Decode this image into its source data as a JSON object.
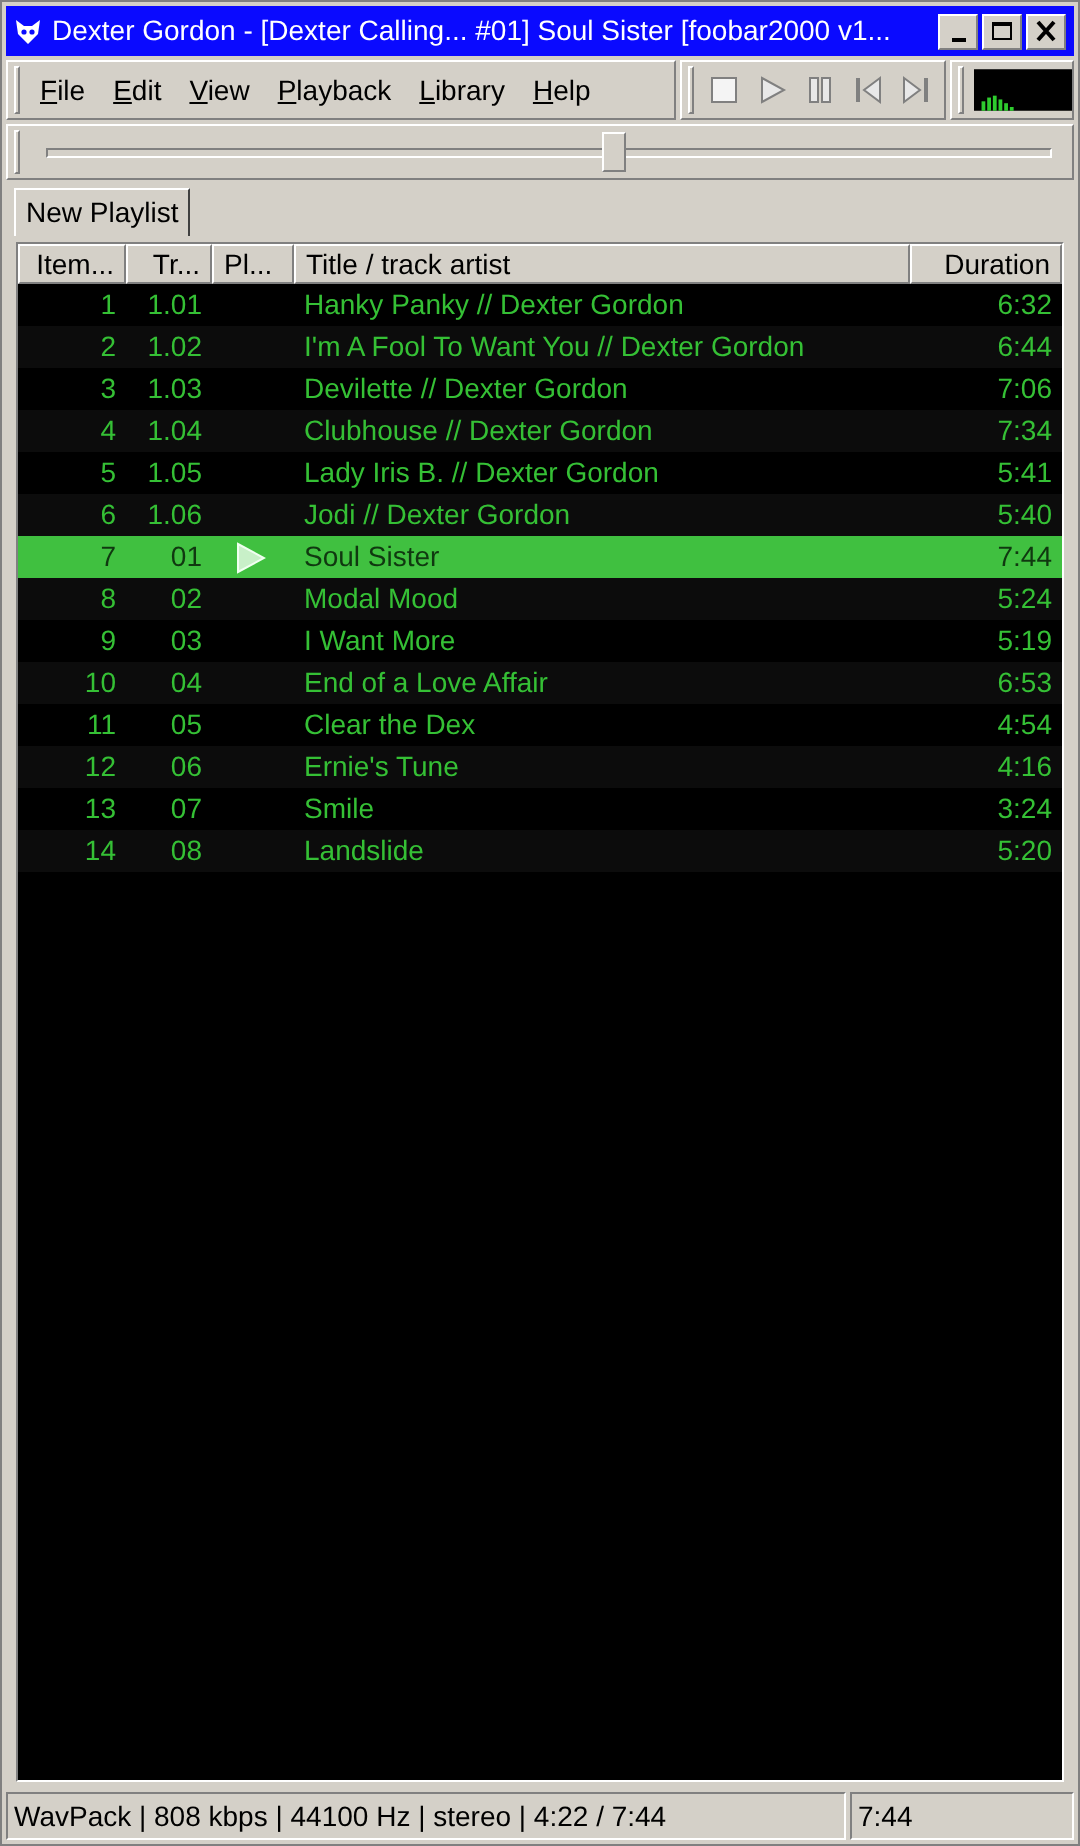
{
  "window": {
    "title": "Dexter Gordon - [Dexter Calling... #01] Soul Sister   [foobar2000 v1..."
  },
  "menu": [
    "File",
    "Edit",
    "View",
    "Playback",
    "Library",
    "Help"
  ],
  "seek": {
    "level": 0.565
  },
  "tabs": [
    {
      "label": "New Playlist",
      "selected": true
    }
  ],
  "columns": [
    "Item...",
    "Tr...",
    "Pl...",
    "Title / track artist",
    "Duration"
  ],
  "rows": [
    {
      "index": "1",
      "track": "1.01",
      "title": "Hanky Panky // Dexter Gordon",
      "duration": "6:32",
      "selected": false,
      "playing": false
    },
    {
      "index": "2",
      "track": "1.02",
      "title": "I'm A Fool To Want You // Dexter Gordon",
      "duration": "6:44",
      "selected": false,
      "playing": false
    },
    {
      "index": "3",
      "track": "1.03",
      "title": "Devilette // Dexter Gordon",
      "duration": "7:06",
      "selected": false,
      "playing": false
    },
    {
      "index": "4",
      "track": "1.04",
      "title": "Clubhouse // Dexter Gordon",
      "duration": "7:34",
      "selected": false,
      "playing": false
    },
    {
      "index": "5",
      "track": "1.05",
      "title": "Lady Iris B. // Dexter Gordon",
      "duration": "5:41",
      "selected": false,
      "playing": false
    },
    {
      "index": "6",
      "track": "1.06",
      "title": "Jodi // Dexter Gordon",
      "duration": "5:40",
      "selected": false,
      "playing": false
    },
    {
      "index": "7",
      "track": "01",
      "title": "Soul Sister",
      "duration": "7:44",
      "selected": true,
      "playing": true
    },
    {
      "index": "8",
      "track": "02",
      "title": "Modal Mood",
      "duration": "5:24",
      "selected": false,
      "playing": false
    },
    {
      "index": "9",
      "track": "03",
      "title": "I Want More",
      "duration": "5:19",
      "selected": false,
      "playing": false
    },
    {
      "index": "10",
      "track": "04",
      "title": "End of a Love Affair",
      "duration": "6:53",
      "selected": false,
      "playing": false
    },
    {
      "index": "11",
      "track": "05",
      "title": "Clear the Dex",
      "duration": "4:54",
      "selected": false,
      "playing": false
    },
    {
      "index": "12",
      "track": "06",
      "title": "Ernie's Tune",
      "duration": "4:16",
      "selected": false,
      "playing": false
    },
    {
      "index": "13",
      "track": "07",
      "title": "Smile",
      "duration": "3:24",
      "selected": false,
      "playing": false
    },
    {
      "index": "14",
      "track": "08",
      "title": "Landslide",
      "duration": "5:20",
      "selected": false,
      "playing": false
    }
  ],
  "status_bar": {
    "info": "WavPack | 808 kbps | 44100 Hz | stereo | 4:22 / 7:44",
    "time": "7:44"
  }
}
